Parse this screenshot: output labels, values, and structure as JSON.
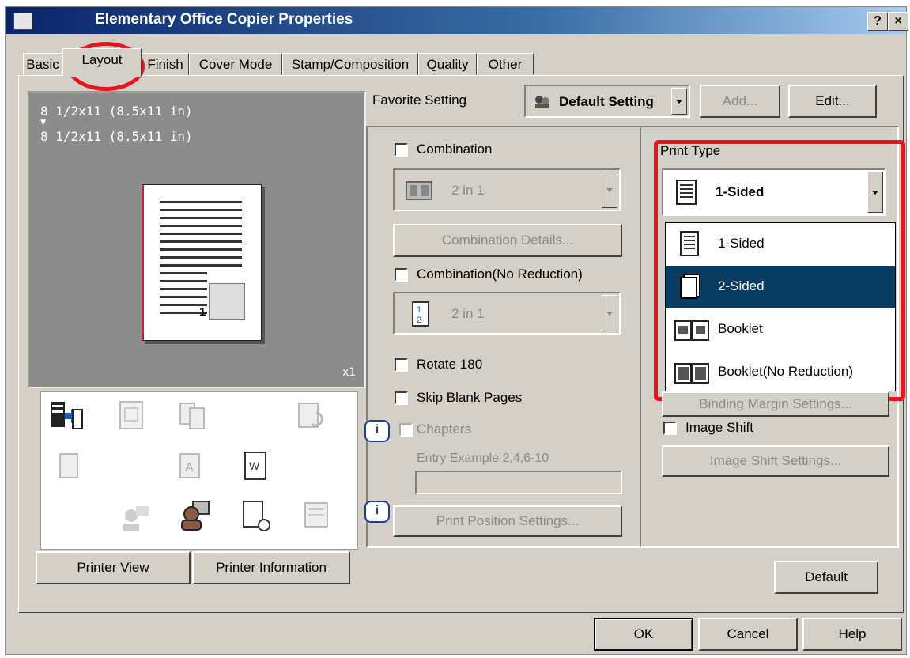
{
  "window": {
    "title": "Elementary Office Copier Properties",
    "help_button": "?",
    "close_button": "×"
  },
  "tabs": [
    "Basic",
    "Layout",
    "Finish",
    "Cover Mode",
    "Stamp/Composition",
    "Quality",
    "Other"
  ],
  "active_tab": "Layout",
  "preview": {
    "paper_original": "8 1/2x11 (8.5x11 in)",
    "arrow": "▼",
    "paper_output": "8 1/2x11 (8.5x11 in)",
    "page_number": "1",
    "copies": "x1"
  },
  "bottom_left_buttons": {
    "printer_view": "Printer View",
    "printer_information": "Printer Information"
  },
  "favorite": {
    "label": "Favorite Setting",
    "value": "Default Setting",
    "add_label": "Add...",
    "edit_label": "Edit..."
  },
  "combination": {
    "label": "Combination",
    "value": "2 in 1",
    "details_label": "Combination Details..."
  },
  "combination_no_reduction": {
    "label": "Combination(No Reduction)",
    "value": "2 in 1"
  },
  "options": {
    "rotate": "Rotate 180",
    "skip_blank": "Skip Blank Pages",
    "chapters": "Chapters",
    "entry_example": "Entry Example 2,4,6-10",
    "print_position": "Print Position Settings..."
  },
  "print_type": {
    "label": "Print Type",
    "selected": "1-Sided",
    "options": [
      "1-Sided",
      "2-Sided",
      "Booklet",
      "Booklet(No Reduction)"
    ],
    "highlighted": "2-Sided",
    "binding_margin": "Binding Margin Settings..."
  },
  "image_shift": {
    "label": "Image Shift",
    "settings_label": "Image Shift Settings..."
  },
  "default_button": "Default",
  "footer": {
    "ok": "OK",
    "cancel": "Cancel",
    "help": "Help"
  },
  "colors": {
    "highlight": "#e8141b",
    "selection": "#0a3d62",
    "title_bar": "#0a246a"
  }
}
